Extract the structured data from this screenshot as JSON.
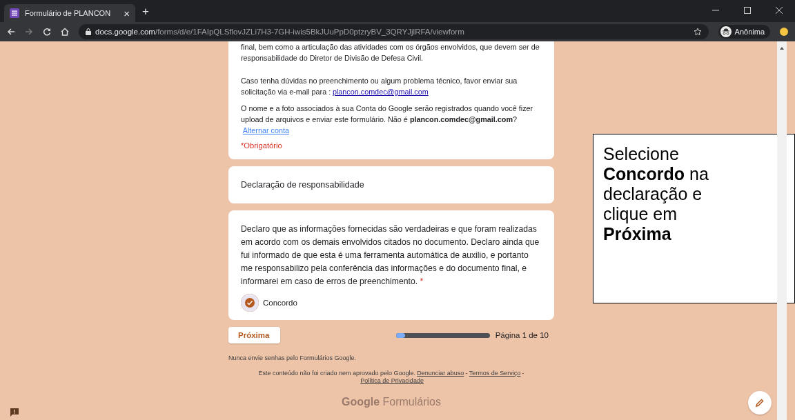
{
  "browser": {
    "tab_title": "Formulário de PLANCON",
    "close_glyph": "×",
    "new_tab_glyph": "+",
    "url_host": "docs.google.com",
    "url_path": "/forms/d/e/1FAIpQLSflovJZLi7H3-7GH-iwis5BkJUuPpD0ptzryBV_3QRYJjlRFA/viewform",
    "profile_label": "Anônima"
  },
  "form": {
    "intro_paragraphs": [
      {
        "text": "final, bem como a articulação das atividades com os órgãos envolvidos, que devem ser de responsabilidade do Diretor de Divisão de Defesa Civil."
      },
      {
        "text": "Caso tenha dúvidas no preenchimento ou algum problema técnico, favor enviar sua solicitação via e-mail para :",
        "link": "plancon.comdec@gmail.com"
      },
      {
        "text": "O nome e a foto associados à sua Conta do Google serão registrados quando você fizer upload de arquivos e enviar este formulário. Não é **plancon.comdec@gmail.com**?",
        "link": "Alternar conta"
      }
    ],
    "required_note": "*Obrigatório",
    "section_title": "Declaração de responsabilidade",
    "question": {
      "text": "Declaro que as informações fornecidas são verdadeiras e que foram realizadas em acordo com os demais envolvidos citados no documento. Declaro ainda que fui informado de que esta é uma ferramenta automática de auxilio, e portanto me responsabilizo pela conferência das informações e do documento final, e informarei em caso de erros de preenchimento.",
      "required_mark": "*",
      "option": {
        "label": "Concordo",
        "checked": true
      }
    },
    "next_button": "Próxima",
    "progress": {
      "level": 0.1,
      "label": "Página 1 de 10"
    },
    "footer": {
      "warning": "Nunca envie senhas pelo Formulários Google.",
      "disclaimer": "Este conteúdo não foi criado nem aprovado pelo Google.",
      "links": [
        "Denunciar abuso",
        "Termos de Serviço",
        "Política de Privacidade"
      ],
      "separator": "-",
      "brand_strong": "Google",
      "brand_light": "Formulários"
    }
  },
  "callout": {
    "text": "Selecione **Concordo** na declaração e clique em **Próxima**"
  }
}
